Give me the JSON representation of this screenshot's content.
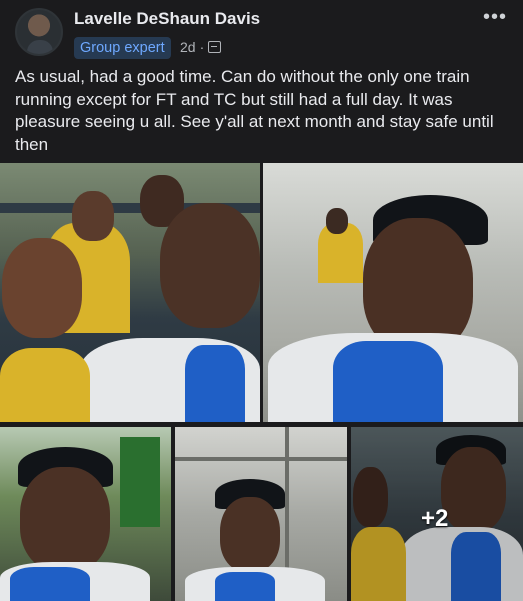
{
  "post": {
    "author": "Lavelle DeShaun Davis",
    "badge": "Group expert",
    "time": "2d",
    "more_glyph": "•••",
    "text": "As usual, had a good time. Can do without the only one train running except for FT and TC but still had a full day. It was pleasure seeing u all. See y'all at next month and stay safe until then"
  },
  "icons": {
    "audience": "photo-icon",
    "more": "more-options-icon"
  },
  "photos": {
    "overflow_label": "+2"
  },
  "colors": {
    "background": "#1b1b1d",
    "badge_bg": "#263a52",
    "badge_text": "#6ea8ff"
  }
}
